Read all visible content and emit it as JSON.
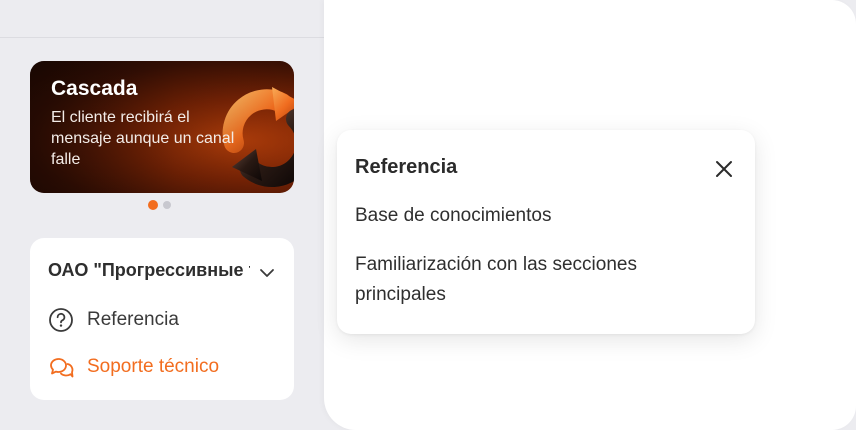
{
  "banner": {
    "title": "Cascada",
    "description": "El cliente recibirá el mensaje aunque un canal falle",
    "dots_count": 2,
    "active_dot": 0
  },
  "sidebar": {
    "organization": "ОАО \"Прогрессивные технологии\"",
    "items": [
      {
        "label": "Referencia",
        "icon": "help-circle-icon"
      },
      {
        "label": "Soporte técnico",
        "icon": "chat-bubbles-icon"
      }
    ]
  },
  "popup": {
    "title": "Referencia",
    "links": [
      "Base de conocimientos",
      "Familiarización con las secciones principales"
    ],
    "close_icon": "close-icon"
  },
  "colors": {
    "accent": "#f26d1f",
    "sidebar_bg": "#ececf0",
    "panel_bg": "#ffffff"
  }
}
